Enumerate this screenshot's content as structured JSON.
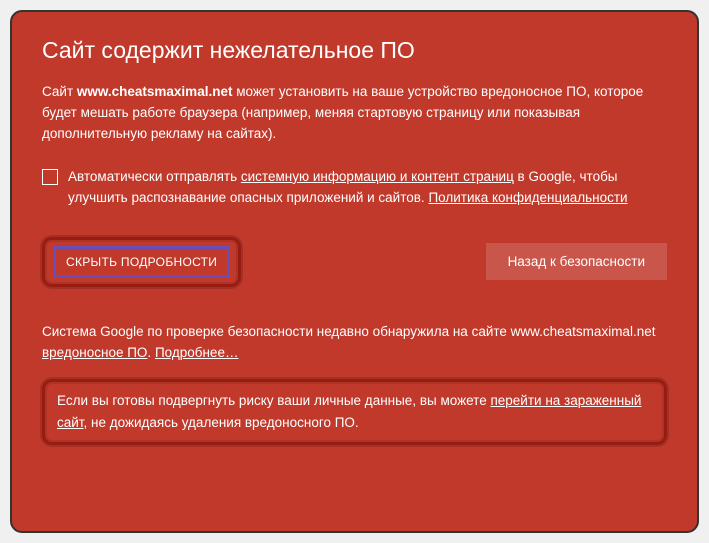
{
  "colors": {
    "bg": "#c0392b",
    "highlight_border": "#9a1b0f"
  },
  "title": "Сайт содержит нежелательное ПО",
  "desc_prefix": "Сайт ",
  "desc_domain": "www.cheatsmaximal.net",
  "desc_suffix": " может установить на ваше устройство вредоносное ПО, которое будет мешать работе браузера (например, меняя стартовую страницу или показывая дополнительную рекламу на сайтах).",
  "checkbox": {
    "t1": "Автоматически отправлять ",
    "link1": "системную информацию и контент страниц",
    "t2": " в Google, чтобы улучшить распознавание опасных приложений и сайтов. ",
    "link2": "Политика конфиденциальности"
  },
  "buttons": {
    "hide": "СКРЫТЬ ПОДРОБНОСТИ",
    "back": "Назад к безопасности"
  },
  "details": {
    "t1": "Система Google по проверке безопасности недавно обнаружила на сайте www.cheatsmaximal.net ",
    "link1": "вредоносное ПО",
    "t2": ". ",
    "link2": "Подробнее…"
  },
  "proceed": {
    "t1": "Если вы готовы подвергнуть риску ваши личные данные, вы можете ",
    "link": "перейти на зараженный сайт",
    "t2": ", не дожидаясь удаления вредоносного ПО."
  }
}
